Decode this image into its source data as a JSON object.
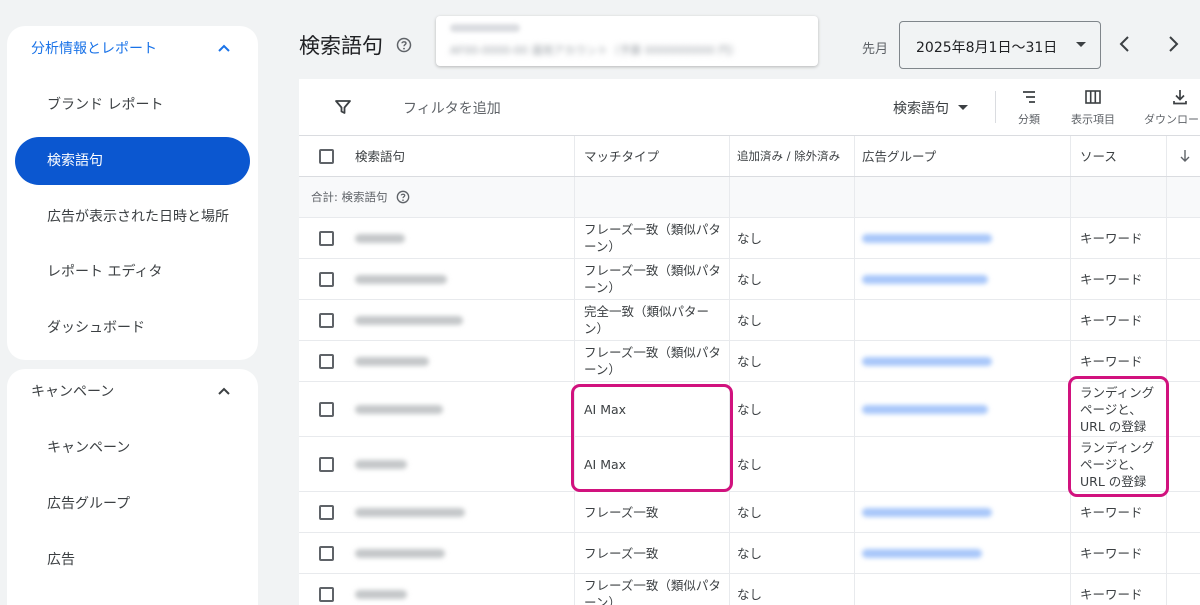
{
  "sidebar": {
    "section1": {
      "title": "分析情報とレポート",
      "items": [
        "ブランド レポート",
        "検索語句",
        "広告が表示された日時と場所",
        "レポート エディタ",
        "ダッシュボード"
      ]
    },
    "section2": {
      "title": "キャンペーン",
      "items": [
        "キャンペーン",
        "広告グループ",
        "広告"
      ]
    }
  },
  "header": {
    "title": "検索語句",
    "account_line": "AF00-0000-00 運用アカウント（予算 0000000000 円）",
    "period_label": "先月",
    "date_range": "2025年8月1日〜31日"
  },
  "toolbar": {
    "filter_placeholder": "フィルタを追加",
    "scope_select": "検索語句",
    "segment_label": "分類",
    "columns_label": "表示項目",
    "download_label": "ダウンロード"
  },
  "table": {
    "headers": [
      "検索語句",
      "マッチタイプ",
      "追加済み / 除外済み",
      "広告グループ",
      "ソース"
    ],
    "total_label": "合計: 検索語句",
    "rows": [
      {
        "match": "フレーズ一致（類似パターン）",
        "status": "なし",
        "source": "キーワード"
      },
      {
        "match": "フレーズ一致（類似パターン）",
        "status": "なし",
        "source": "キーワード"
      },
      {
        "match": "完全一致（類似パターン）",
        "status": "なし",
        "source": "キーワード"
      },
      {
        "match": "フレーズ一致（類似パターン）",
        "status": "なし",
        "source": "キーワード"
      },
      {
        "match": "AI Max",
        "status": "なし",
        "source": "ランディング ページと、URL の登録"
      },
      {
        "match": "AI Max",
        "status": "なし",
        "source": "ランディング ページと、URL の登録"
      },
      {
        "match": "フレーズ一致",
        "status": "なし",
        "source": "キーワード"
      },
      {
        "match": "フレーズ一致",
        "status": "なし",
        "source": "キーワード"
      },
      {
        "match": "フレーズ一致（類似パターン）",
        "status": "なし",
        "source": "キーワード"
      }
    ]
  },
  "colors": {
    "accent": "#0b57d0",
    "highlight": "#d1127e"
  }
}
